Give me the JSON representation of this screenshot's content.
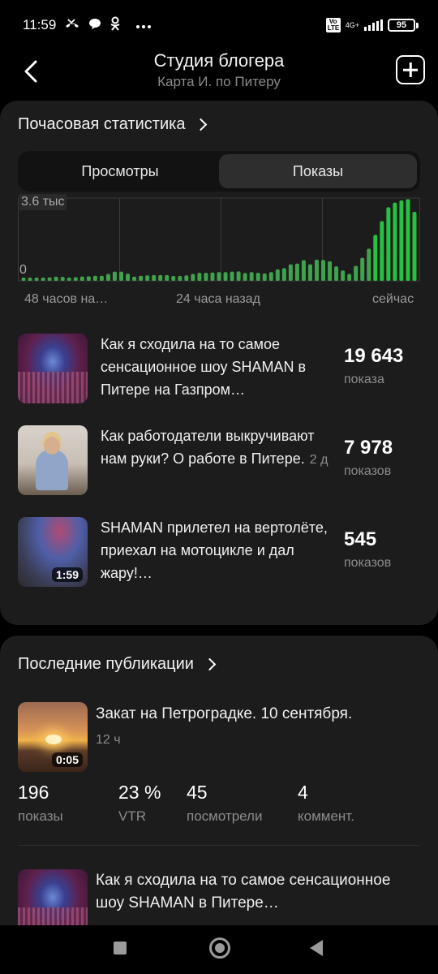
{
  "status_bar": {
    "time": "11:59",
    "network": "4G+",
    "volte": "Vo LTE",
    "battery": "95",
    "icons": [
      "missed-call-icon",
      "chat-icon",
      "odnoklassniki-icon",
      "more-dots-icon"
    ]
  },
  "header": {
    "title": "Студия блогера",
    "subtitle": "Карта И. по Питеру"
  },
  "hourly": {
    "title": "Почасовая статистика",
    "tabs": [
      {
        "label": "Просмотры",
        "active": false
      },
      {
        "label": "Показы",
        "active": true
      }
    ],
    "chart_max": "3.6 тыс",
    "chart_min": "0",
    "x_labels": [
      "48 часов на…",
      "24 часа назад",
      "сейчас"
    ],
    "items": [
      {
        "title": "Как я сходила на то самое сенсационное шоу SHAMAN в Питере на Газпром…",
        "age": "",
        "count": "19 643",
        "unit": "показа",
        "duration": ""
      },
      {
        "title": "Как работодатели выкручивают нам руки? О работе в Питере.",
        "age": "2 д",
        "count": "7 978",
        "unit": "показов",
        "duration": ""
      },
      {
        "title": "SHAMAN прилетел на вертолёте, приехал на мотоцикле и дал жару!…",
        "age": "",
        "count": "545",
        "unit": "показов",
        "duration": "1:59"
      }
    ]
  },
  "chart_data": {
    "type": "bar",
    "title": "",
    "xlabel": "",
    "ylabel": "",
    "ylim": [
      0,
      3600
    ],
    "x_tick_labels": [
      "48 часов на…",
      "24 часа назад",
      "сейчас"
    ],
    "y_tick_labels": [
      "0",
      "3.6 тыс"
    ],
    "grid": true,
    "values": [
      60,
      100,
      120,
      130,
      150,
      180,
      170,
      120,
      160,
      190,
      200,
      220,
      220,
      300,
      400,
      400,
      310,
      180,
      220,
      240,
      250,
      250,
      250,
      210,
      210,
      240,
      300,
      350,
      350,
      360,
      380,
      380,
      400,
      410,
      340,
      380,
      350,
      320,
      380,
      500,
      550,
      720,
      750,
      900,
      720,
      920,
      910,
      850,
      630,
      450,
      300,
      650,
      1000,
      1400,
      2000,
      2600,
      3200,
      3400,
      3500,
      3550,
      3000
    ],
    "colors": {
      "low": "#3fa34d",
      "high": "#27c040"
    }
  },
  "recent": {
    "title": "Последние публикации",
    "items": [
      {
        "title": "Закат на Петроградке. 10 сентября.",
        "age": "12 ч",
        "duration": "0:05",
        "stats": [
          {
            "value": "196",
            "label": "показы"
          },
          {
            "value": "23 %",
            "label": "VTR"
          },
          {
            "value": "45",
            "label": "посмотрели"
          },
          {
            "value": "4",
            "label": "коммент."
          }
        ]
      },
      {
        "title": "Как я сходила на то самое сенсационное шоу SHAMAN в Питере…",
        "age": "",
        "duration": ""
      }
    ]
  }
}
